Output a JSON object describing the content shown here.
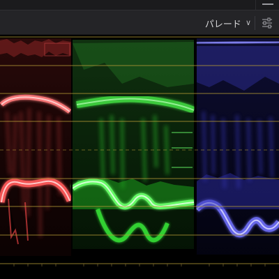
{
  "toolbar": {
    "mode_label": "パレード",
    "mode_chevron": "∨",
    "settings_icon": "sliders-icon",
    "menu_icon": "menu-icon"
  },
  "scope": {
    "type": "rgb-parade",
    "channels": [
      {
        "name": "red",
        "color": "#ff3a3a"
      },
      {
        "name": "green",
        "color": "#39ff39"
      },
      {
        "name": "blue",
        "color": "#5b5bff"
      }
    ],
    "graticule_color": "#b59a35"
  }
}
